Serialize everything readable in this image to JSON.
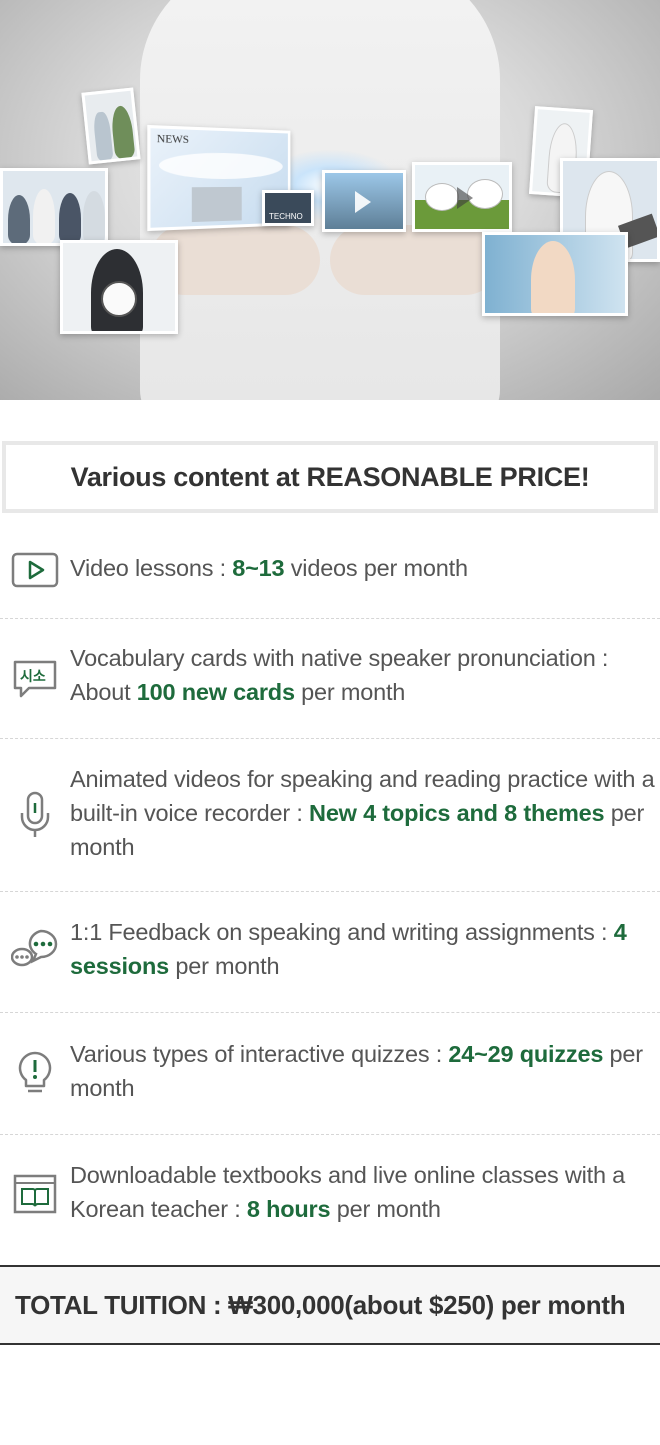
{
  "headline": "Various content at REASONABLE PRICE!",
  "accent_color": "#1e6b3c",
  "hero": {
    "icon": "video-screen-collage",
    "news_label": "NEWS",
    "tech_label": "TECHNO"
  },
  "features": [
    {
      "icon": "play-icon",
      "prefix": "Video lessons : ",
      "highlight": "8~13",
      "suffix": " videos per month"
    },
    {
      "icon": "speech-bubble-korean-icon",
      "icon_text": "시소",
      "prefix": "Vocabulary cards with native speaker pronunciation : About ",
      "highlight": "100 new cards",
      "suffix": " per month"
    },
    {
      "icon": "microphone-icon",
      "prefix": "Animated videos for speaking and reading practice with a built-in voice recorder : ",
      "highlight": "New 4 topics and 8 themes",
      "suffix": " per month"
    },
    {
      "icon": "chat-bubbles-icon",
      "prefix": "1:1 Feedback on speaking and writing assignments : ",
      "highlight": "4 sessions",
      "suffix": " per month"
    },
    {
      "icon": "lightbulb-exclamation-icon",
      "prefix": "Various types of interactive quizzes : ",
      "highlight": "24~29 quizzes",
      "suffix": " per month"
    },
    {
      "icon": "book-window-icon",
      "prefix": "Downloadable textbooks and live online classes with a Korean teacher : ",
      "highlight": "8 hours",
      "suffix": " per month"
    }
  ],
  "total": "TOTAL TUITION : ₩300,000(about $250) per month"
}
